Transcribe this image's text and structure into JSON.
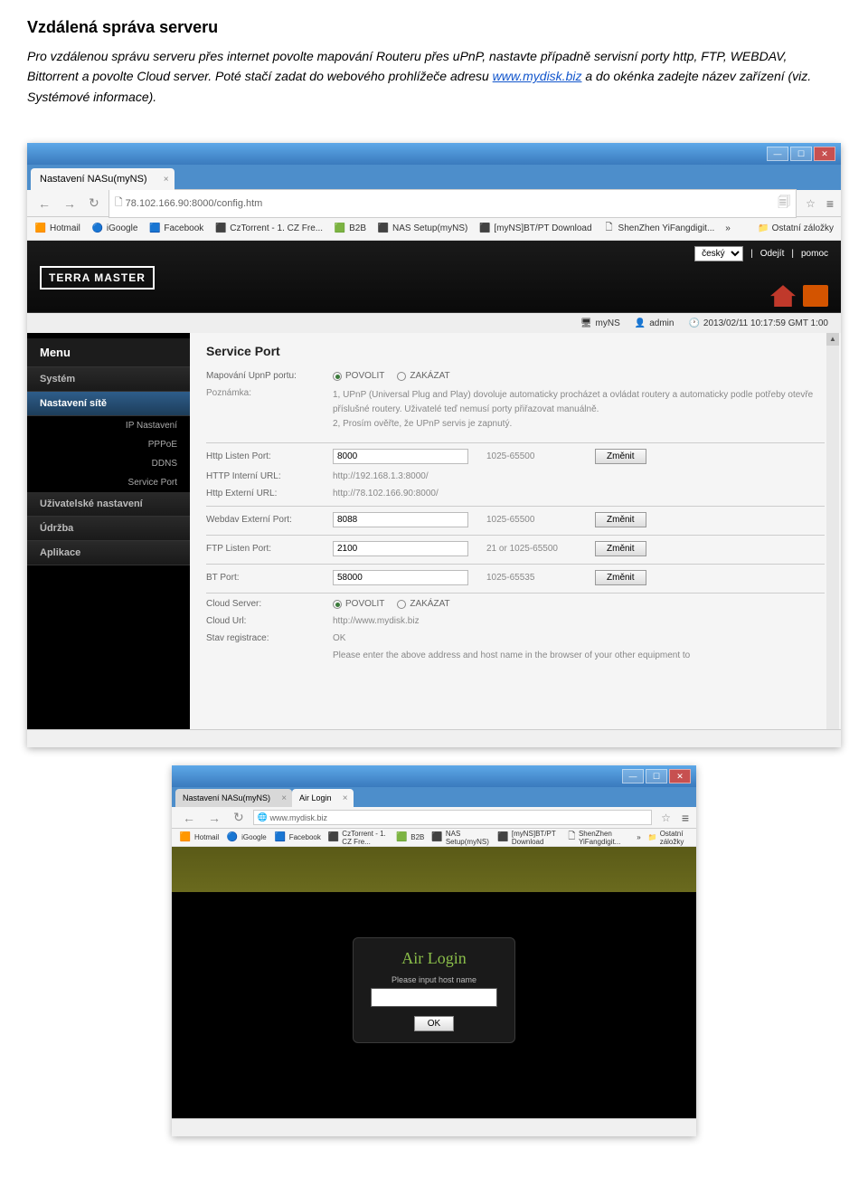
{
  "doc": {
    "title": "Vzdálená správa serveru",
    "text_1": "Pro vzdálenou správu serveru přes internet povolte mapování Routeru přes uPnP, nastavte případně servisní porty http, FTP, WEBDAV,   Bittorrent a povolte Cloud server.    Poté stačí zadat do webového prohlížeče adresu ",
    "link_text": "www.mydisk.biz",
    "text_2": "    a do okénka zadejte název zařízení (viz. Systémové informace)."
  },
  "browser1": {
    "tab_title": "Nastavení NASu(myNS)",
    "url": "78.102.166.90:8000/config.htm",
    "bookmarks": {
      "hotmail": "Hotmail",
      "igoogle": "iGoogle",
      "facebook": "Facebook",
      "cztorrent": "CzTorrent - 1. CZ Fre...",
      "b2b": "B2B",
      "nas_setup": "NAS Setup(myNS)",
      "mynas_bt": "[myNS]BT/PT Download",
      "shenzhen": "ShenZhen YiFangdigit...",
      "other": "Ostatní záložky",
      "more": "»"
    }
  },
  "nas": {
    "logo": "TERRA MASTER",
    "lang": "český",
    "logout": "Odejít",
    "help": "pomoc",
    "status": {
      "device": "myNS",
      "user": "admin",
      "time": "2013/02/11 10:17:59 GMT 1:00"
    },
    "menu": {
      "title": "Menu",
      "system": "Systém",
      "network": "Nastavení sítě",
      "ip": "IP Nastavení",
      "pppoe": "PPPoE",
      "ddns": "DDNS",
      "service_port": "Service Port",
      "user_settings": "Uživatelské nastavení",
      "maintenance": "Údržba",
      "apps": "Aplikace"
    },
    "panel": {
      "title": "Service Port",
      "upnp_label": "Mapování UpnP portu:",
      "enable": "POVOLIT",
      "disable": "ZAKÁZAT",
      "note_label": "Poznámka:",
      "note_1": "1, UPnP (Universal Plug and Play) dovoluje automaticky procházet a ovládat routery a automaticky podle potřeby otevře příslušné routery. Uživatelé teď nemusí porty přiřazovat manuálně.",
      "note_2": "2, Prosím ověřte, že UPnP servis je zapnutý.",
      "http_port_label": "Http Listen Port:",
      "http_port_value": "8000",
      "http_range": "1025-65500",
      "change_btn": "Změnit",
      "http_internal_label": "HTTP Interní URL:",
      "http_internal_value": "http://192.168.1.3:8000/",
      "http_external_label": "Http Externí URL:",
      "http_external_value": "http://78.102.166.90:8000/",
      "webdav_label": "Webdav Externí Port:",
      "webdav_value": "8088",
      "webdav_range": "1025-65500",
      "ftp_label": "FTP Listen Port:",
      "ftp_value": "2100",
      "ftp_range": "21 or 1025-65500",
      "bt_label": "BT Port:",
      "bt_value": "58000",
      "bt_range": "1025-65535",
      "cloud_label": "Cloud Server:",
      "cloud_url_label": "Cloud Url:",
      "cloud_url_value": "http://www.mydisk.biz",
      "reg_label": "Stav registrace:",
      "reg_value": "OK",
      "footer_note": "Please enter the above address and host name in the browser of your other equipment to"
    }
  },
  "browser2": {
    "tab1": "Nastavení NASu(myNS)",
    "tab2": "Air Login",
    "url": "www.mydisk.biz",
    "login": {
      "title": "Air Login",
      "label": "Please input host name",
      "ok": "OK"
    }
  }
}
